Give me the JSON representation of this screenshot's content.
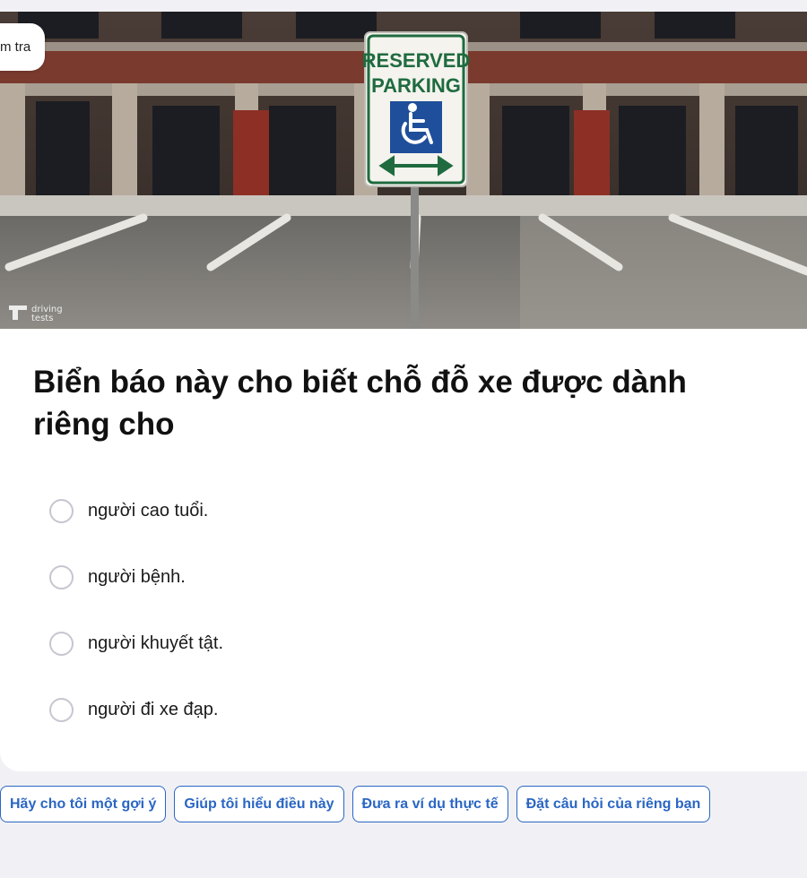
{
  "header": {
    "back_label": "m tra"
  },
  "image": {
    "sign_line1": "RESERVED",
    "sign_line2": "PARKING",
    "watermark_line1": "driving",
    "watermark_line2": "tests",
    "sign_green": "#1f6b3f",
    "sign_blue": "#1f4f9a"
  },
  "question": {
    "text": "Biển báo này cho biết chỗ đỗ xe được dành riêng cho"
  },
  "options": [
    {
      "label": "người cao tuổi."
    },
    {
      "label": "người bệnh."
    },
    {
      "label": "người khuyết tật."
    },
    {
      "label": "người đi xe đạp."
    }
  ],
  "suggestions": [
    {
      "label": "Hãy cho tôi một gợi ý"
    },
    {
      "label": "Giúp tôi hiểu điều này"
    },
    {
      "label": "Đưa ra ví dụ thực tế"
    },
    {
      "label": "Đặt câu hỏi của riêng bạn"
    }
  ],
  "colors": {
    "accent": "#2a66c4",
    "background": "#f1f1f5"
  }
}
